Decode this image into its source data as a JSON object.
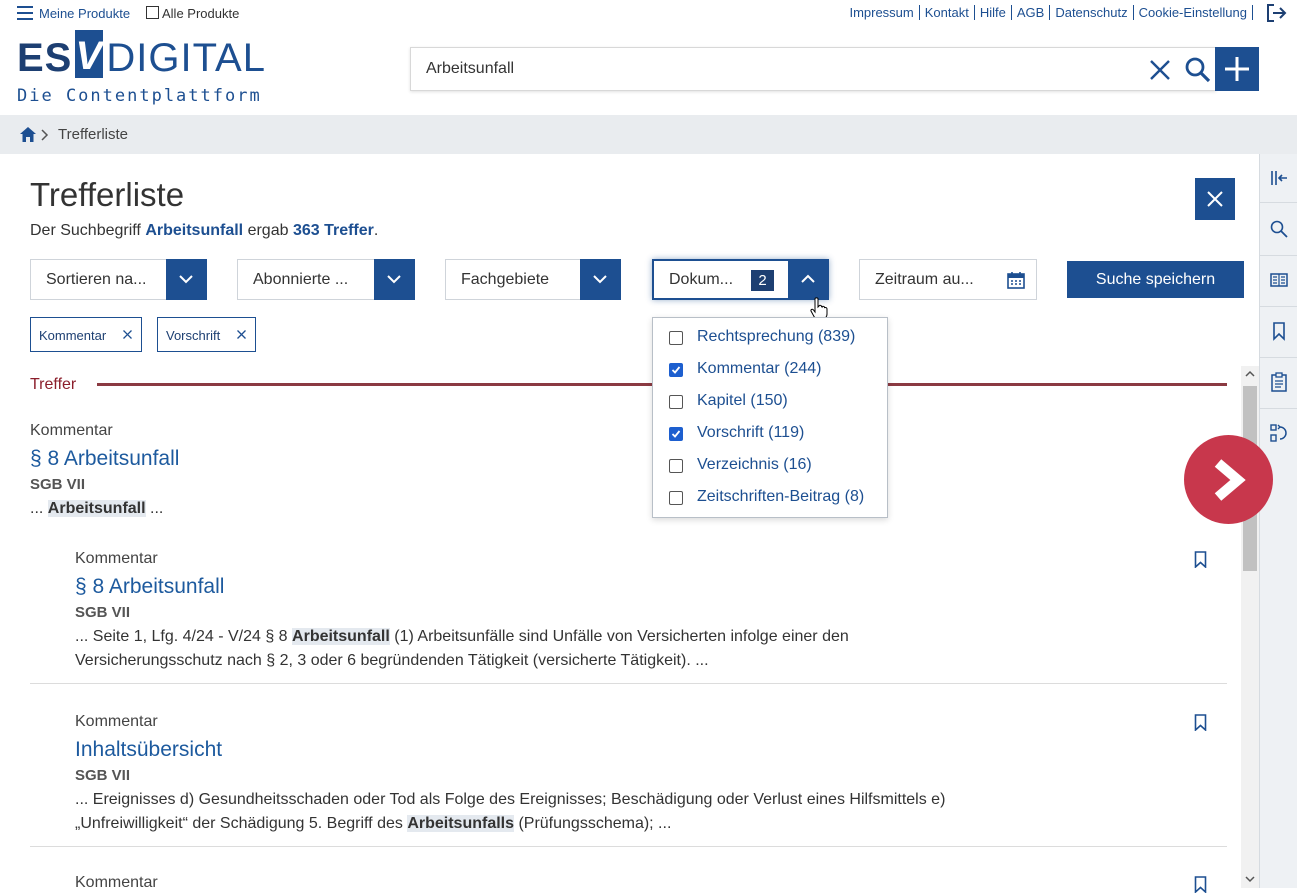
{
  "topbar": {
    "my_products": "Meine Produkte",
    "all_products": "Alle Produkte",
    "util_links": [
      "Impressum",
      "Kontakt",
      "Hilfe",
      "AGB",
      "Datenschutz",
      "Cookie-Einstellung"
    ]
  },
  "logo": {
    "es": "ES",
    "v": "V",
    "digital": "DIGITAL",
    "tagline": "Die Contentplattform"
  },
  "search": {
    "value": "Arbeitsunfall"
  },
  "breadcrumb": {
    "current": "Trefferliste"
  },
  "main": {
    "title": "Trefferliste",
    "summary_prefix": "Der Suchbegriff ",
    "summary_term": "Arbeitsunfall",
    "summary_mid": " ergab ",
    "summary_count": "363 Treffer",
    "summary_suffix": "."
  },
  "filters": {
    "sort": "Sortieren na...",
    "subscribed": "Abonnierte ...",
    "fields": "Fachgebiete",
    "doctype": "Dokum...",
    "doctype_count": "2",
    "period": "Zeitraum au...",
    "save": "Suche speichern"
  },
  "chips": [
    "Kommentar",
    "Vorschrift"
  ],
  "doctype_menu": [
    {
      "label": "Rechtsprechung (839)",
      "checked": false
    },
    {
      "label": "Kommentar (244)",
      "checked": true
    },
    {
      "label": "Kapitel (150)",
      "checked": false
    },
    {
      "label": "Vorschrift (119)",
      "checked": true
    },
    {
      "label": "Verzeichnis (16)",
      "checked": false
    },
    {
      "label": "Zeitschriften-Beitrag (8)",
      "checked": false
    }
  ],
  "section_label": "Treffer",
  "results": [
    {
      "type": "Kommentar",
      "title": "§ 8 Arbeitsunfall",
      "source": "SGB VII",
      "snippet_pre": "... ",
      "snippet_hl": "Arbeitsunfall",
      "snippet_post": " ..."
    },
    {
      "type": "Kommentar",
      "title": "§ 8 Arbeitsunfall",
      "source": "SGB VII",
      "line1_pre": "... Seite 1, Lfg. 4/24 - V/24 § 8 ",
      "line1_hl": "Arbeitsunfall",
      "line1_post": " (1) Arbeitsunfälle sind Unfälle von Versicherten infolge einer den",
      "line2": "Versicherungsschutz nach § 2, 3 oder 6 begründenden Tätigkeit (versicherte Tätigkeit). ..."
    },
    {
      "type": "Kommentar",
      "title": "Inhaltsübersicht",
      "source": "SGB VII",
      "line1": "... Ereignisses d) Gesundheitsschaden oder Tod als Folge des Ereignisses; Beschädigung oder Verlust eines Hilfsmittels e)",
      "line2_pre": "„Unfreiwilligkeit“ der Schädigung 5. Begriff des ",
      "line2_hl": "Arbeitsunfalls",
      "line2_post": " (Prüfungsschema); ..."
    },
    {
      "type": "Kommentar"
    }
  ],
  "colors": {
    "primary": "#1d4f91",
    "accent_red": "#c8374c",
    "section_line": "#8b3a42"
  }
}
